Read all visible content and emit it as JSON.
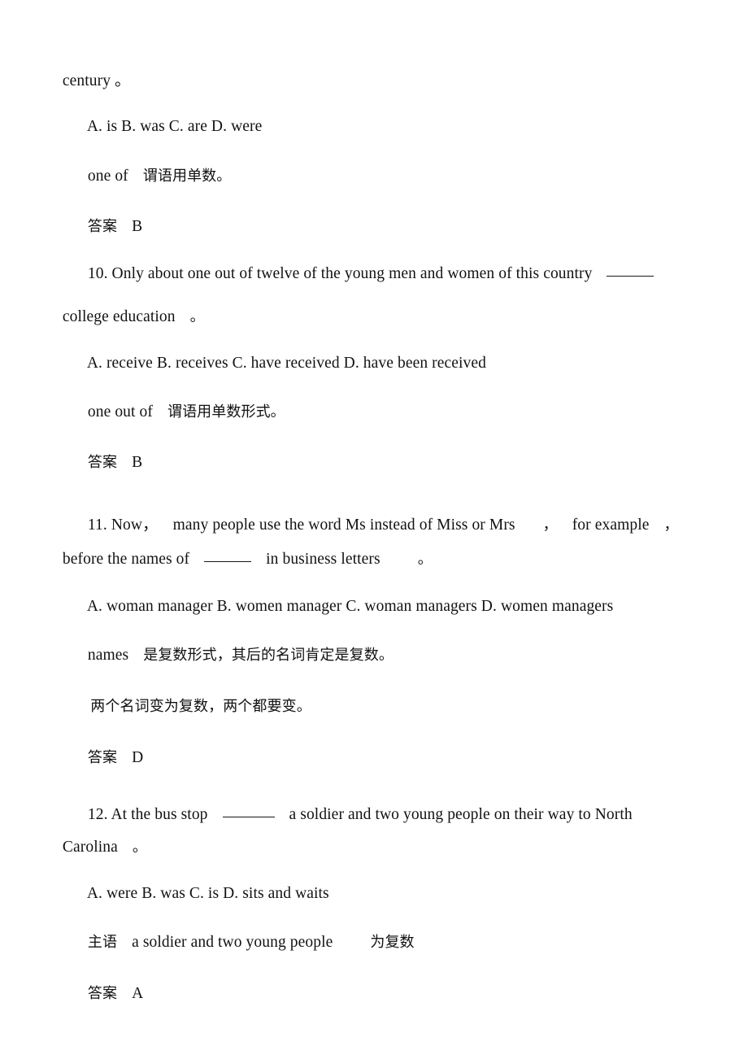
{
  "document": {
    "type": "grammar-exercise-answer-key",
    "language": "mixed-english-chinese",
    "background_color": "#ffffff",
    "text_color": "#121212"
  },
  "lines": {
    "q9_stem_continuation": "century 。",
    "q9_options": "A. is B. was C. are D. were",
    "q9_explanation_en": "one of",
    "q9_explanation_cn": "谓语用单数。",
    "q9_answer_label": "答案",
    "q9_answer_value": "B",
    "q10_stem_part1": "10. Only about one out of twelve of the young men and women of this country",
    "q10_stem_part2": "college education",
    "q10_stem_part2_period": "。",
    "q10_options": "A. receive B. receives C. have received D. have been received",
    "q10_explanation_en": "one out of",
    "q10_explanation_cn": "谓语用单数形式。",
    "q10_answer_label": "答案",
    "q10_answer_value": "B",
    "q11_stem_part1a": "11. Now，",
    "q11_stem_part1b": "many people use the word Ms instead of Miss or Mrs",
    "q11_stem_part1c": "，",
    "q11_stem_part1d": "for example",
    "q11_stem_part1e": "，",
    "q11_stem_part2a": "before the names of",
    "q11_stem_part2b": "in business letters",
    "q11_stem_part2c": "。",
    "q11_options": "A. woman manager B. women manager C. woman managers D. women managers",
    "q11_explanation_en": "names",
    "q11_explanation_cn": "是复数形式，其后的名词肯定是复数。",
    "q11_explanation_cn2": "两个名词变为复数，两个都要变。",
    "q11_answer_label": "答案",
    "q11_answer_value": "D",
    "q12_stem_part1a": "12. At the bus stop",
    "q12_stem_part1b": "a soldier and two young people on their way to North",
    "q12_stem_part2": "Carolina",
    "q12_stem_part2_period": "。",
    "q12_options": "A. were B. was C. is D. sits and waits",
    "q12_explanation_cn1": "主语",
    "q12_explanation_en": "a soldier and two young people",
    "q12_explanation_cn2": "为复数",
    "q12_answer_label": "答案",
    "q12_answer_value": "A"
  }
}
